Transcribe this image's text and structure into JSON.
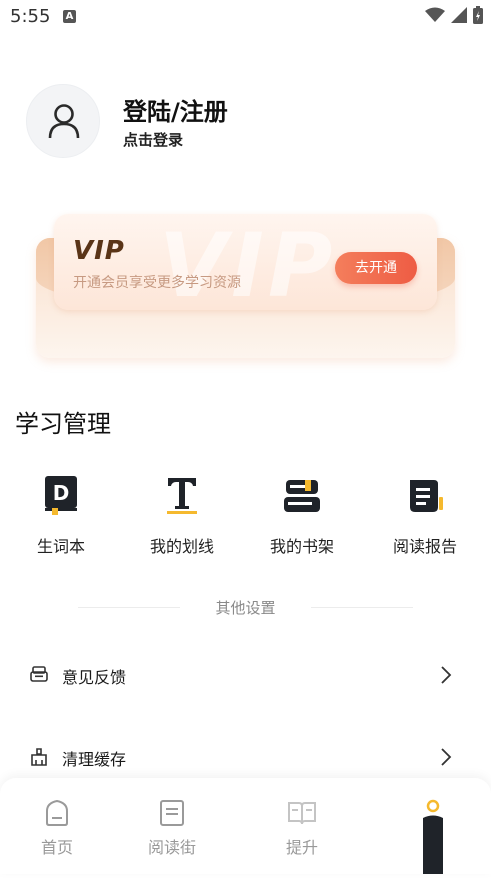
{
  "status_bar": {
    "time": "5:55",
    "notification_icon": "A"
  },
  "profile": {
    "title": "登陆/注册",
    "subtitle": "点击登录",
    "icon": "user-icon"
  },
  "vip": {
    "logo": "VIP",
    "watermark": "VIP",
    "description": "开通会员享受更多学习资源",
    "button": "去开通",
    "colors": {
      "button": "#ee5c44",
      "logo": "#5a3417",
      "card": "#fde6d8"
    }
  },
  "study": {
    "title": "学习管理",
    "items": [
      {
        "label": "生词本",
        "icon": "vocabulary-book-icon"
      },
      {
        "label": "我的划线",
        "icon": "text-underline-icon"
      },
      {
        "label": "我的书架",
        "icon": "bookshelf-icon"
      },
      {
        "label": "阅读报告",
        "icon": "reading-report-icon"
      }
    ]
  },
  "other_settings": {
    "title": "其他设置",
    "items": [
      {
        "label": "意见反馈",
        "icon": "feedback-icon"
      },
      {
        "label": "清理缓存",
        "icon": "clean-cache-icon"
      }
    ]
  },
  "bottom_nav": {
    "items": [
      {
        "label": "首页",
        "icon": "home-icon"
      },
      {
        "label": "阅读街",
        "icon": "reading-street-icon"
      },
      {
        "label": "提升",
        "icon": "improve-book-icon"
      }
    ],
    "active_icon": "me-icon"
  }
}
